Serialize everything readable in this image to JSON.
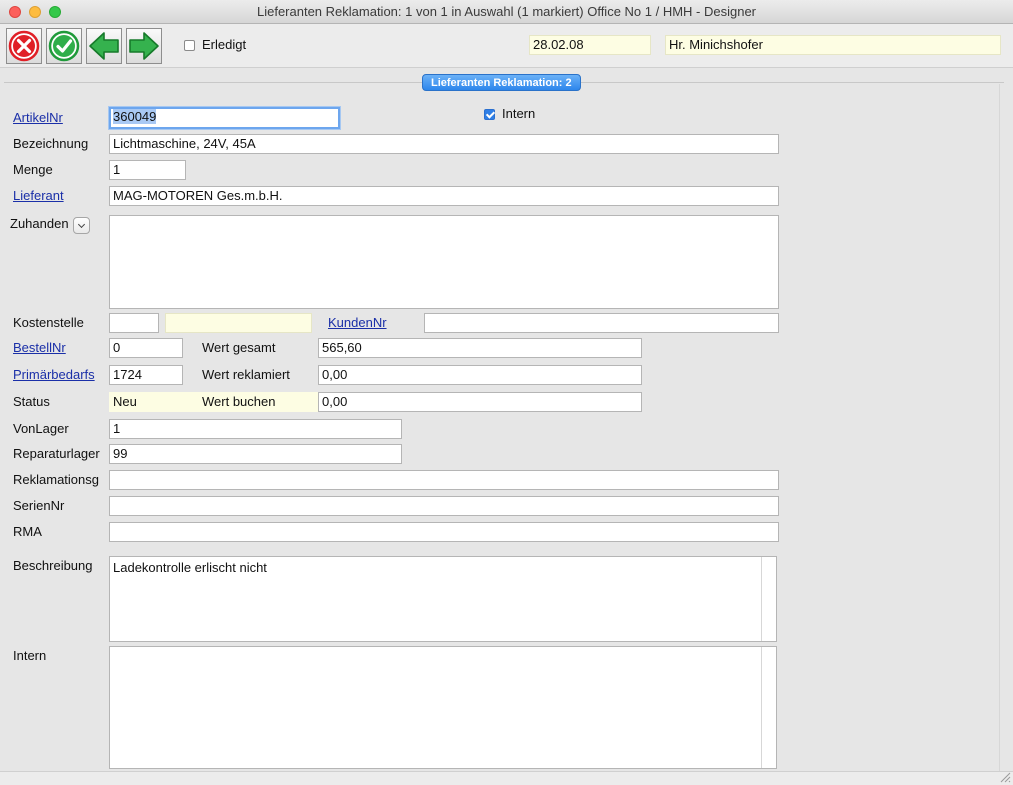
{
  "window": {
    "title": "Lieferanten Reklamation: 1 von 1 in Auswahl  (1 markiert) Office No 1 /  HMH - Designer"
  },
  "toolbar": {
    "buttons": [
      {
        "name": "cancel-icon",
        "color": "#e01f26"
      },
      {
        "name": "confirm-icon",
        "color": "#1f9a3a"
      },
      {
        "name": "previous-record-icon",
        "color": "#1f9a3a"
      },
      {
        "name": "next-record-icon",
        "color": "#1f9a3a"
      }
    ],
    "erledigt_label": "Erledigt",
    "erledigt_checked": false,
    "date": "28.02.08",
    "user": "Hr. Minichshofer"
  },
  "tab": {
    "label": "Lieferanten Reklamation: 2"
  },
  "form": {
    "artikelnr_label": "ArtikelNr",
    "artikelnr_value": "360049",
    "intern_check_label": "Intern",
    "intern_checked": true,
    "bezeichnung_label": "Bezeichnung",
    "bezeichnung_value": "Lichtmaschine, 24V, 45A",
    "menge_label": "Menge",
    "menge_value": "1",
    "lieferant_label": "Lieferant",
    "lieferant_value": "MAG-MOTOREN Ges.m.b.H.",
    "zuhanden_label": "Zuhanden",
    "zuhanden_value": "",
    "kostenstelle_label": "Kostenstelle",
    "kostenstelle_value": "",
    "kostenstelle_name": "",
    "kundennr_label": "KundenNr",
    "kundennr_value": "",
    "bestellnr_label": "BestellNr",
    "bestellnr_value": "0",
    "wert_gesamt_label": "Wert gesamt",
    "wert_gesamt_value": "565,60",
    "primaerbedarfs_label": "Primärbedarfs",
    "primaerbedarfs_value": "1724",
    "wert_reklamiert_label": "Wert reklamiert",
    "wert_reklamiert_value": "0,00",
    "status_label": "Status",
    "status_value": "Neu",
    "wert_buchen_label": "Wert buchen",
    "wert_buchen_value": "0,00",
    "vonlager_label": "VonLager",
    "vonlager_value": "1",
    "reparaturlager_label": "Reparaturlager",
    "reparaturlager_value": "99",
    "reklamationsg_label": "Reklamationsg",
    "reklamationsg_value": "",
    "seriennr_label": "SerienNr",
    "seriennr_value": "",
    "rma_label": "RMA",
    "rma_value": "",
    "beschreibung_label": "Beschreibung",
    "beschreibung_value": "Ladekontrolle erlischt nicht",
    "intern_label": "Intern",
    "intern_value": ""
  }
}
